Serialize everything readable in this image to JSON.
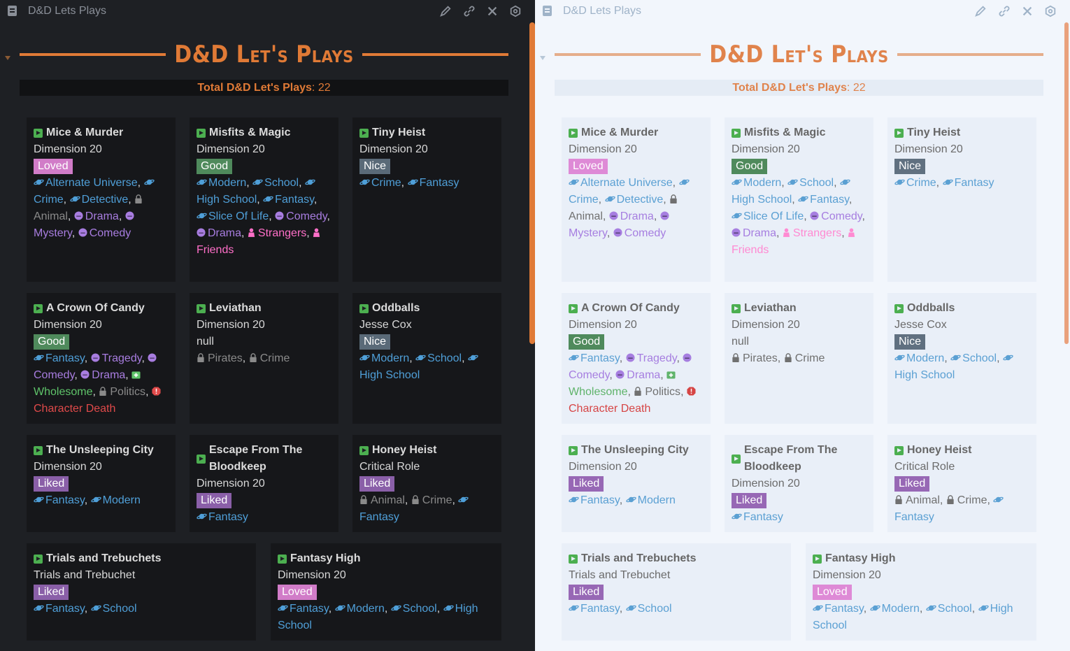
{
  "window": {
    "title": "D&D Lets Plays"
  },
  "heading": "D&D Let's Plays",
  "total": {
    "label": "Total D&D Let's Plays",
    "value": "22"
  },
  "colors": {
    "accent_dark": "#e07a36",
    "accent_light": "#e0834c",
    "genre_tag": "#4f9fd8",
    "mood_tag": "#a87de0",
    "relationship_tag": "#ff6fc8",
    "warning_tag": "#e04a4a",
    "wholesome_tag": "#5fc46a"
  },
  "cards": [
    {
      "name": "Mice & Murder",
      "creator": "Dimension 20",
      "rating": "Loved",
      "rating_class": "loved",
      "tags": [
        {
          "label": "Alternate Universe",
          "kind": "genre",
          "icon": "planet-icon"
        },
        {
          "label": "Crime",
          "kind": "genre",
          "icon": "planet-icon"
        },
        {
          "label": "Detective",
          "kind": "genre",
          "icon": "planet-icon"
        },
        {
          "label": "Animal",
          "kind": "neutral",
          "icon": "lock-icon"
        },
        {
          "label": "Drama",
          "kind": "mood",
          "icon": "face-icon"
        },
        {
          "label": "Mystery",
          "kind": "mood",
          "icon": "face-icon"
        },
        {
          "label": "Comedy",
          "kind": "mood",
          "icon": "face-icon"
        }
      ]
    },
    {
      "name": "Misfits & Magic",
      "creator": "Dimension 20",
      "rating": "Good",
      "rating_class": "good",
      "tags": [
        {
          "label": "Modern",
          "kind": "genre",
          "icon": "planet-icon"
        },
        {
          "label": "School",
          "kind": "genre",
          "icon": "planet-icon"
        },
        {
          "label": "High School",
          "kind": "genre",
          "icon": "planet-icon"
        },
        {
          "label": "Fantasy",
          "kind": "genre",
          "icon": "planet-icon"
        },
        {
          "label": "Slice Of Life",
          "kind": "genre",
          "icon": "planet-icon"
        },
        {
          "label": "Comedy",
          "kind": "mood",
          "icon": "face-icon"
        },
        {
          "label": "Drama",
          "kind": "mood",
          "icon": "face-icon"
        },
        {
          "label": "Strangers",
          "kind": "rel",
          "icon": "person-icon"
        },
        {
          "label": "Friends",
          "kind": "rel",
          "icon": "person-icon"
        }
      ]
    },
    {
      "name": "Tiny Heist",
      "creator": "Dimension 20",
      "rating": "Nice",
      "rating_class": "nice",
      "tags": [
        {
          "label": "Crime",
          "kind": "genre",
          "icon": "planet-icon"
        },
        {
          "label": "Fantasy",
          "kind": "genre",
          "icon": "planet-icon"
        }
      ]
    },
    {
      "name": "A Crown Of Candy",
      "creator": "Dimension 20",
      "rating": "Good",
      "rating_class": "good",
      "tags": [
        {
          "label": "Fantasy",
          "kind": "genre",
          "icon": "planet-icon"
        },
        {
          "label": "Tragedy",
          "kind": "mood",
          "icon": "face-icon"
        },
        {
          "label": "Comedy",
          "kind": "mood",
          "icon": "face-icon"
        },
        {
          "label": "Drama",
          "kind": "mood",
          "icon": "face-icon"
        },
        {
          "label": "Wholesome",
          "kind": "good",
          "icon": "medkit-icon"
        },
        {
          "label": "Politics",
          "kind": "neutral",
          "icon": "lock-icon"
        },
        {
          "label": "Character Death",
          "kind": "warn",
          "icon": "warning-icon"
        }
      ]
    },
    {
      "name": "Leviathan",
      "creator": "Dimension 20",
      "rating": "null",
      "rating_class": "none",
      "tags": [
        {
          "label": "Pirates",
          "kind": "neutral",
          "icon": "lock-icon"
        },
        {
          "label": "Crime",
          "kind": "neutral",
          "icon": "lock-icon"
        }
      ]
    },
    {
      "name": "Oddballs",
      "creator": "Jesse Cox",
      "rating": "Nice",
      "rating_class": "nice",
      "tags": [
        {
          "label": "Modern",
          "kind": "genre",
          "icon": "planet-icon"
        },
        {
          "label": "School",
          "kind": "genre",
          "icon": "planet-icon"
        },
        {
          "label": "High School",
          "kind": "genre",
          "icon": "planet-icon"
        }
      ]
    },
    {
      "name": "The Unsleeping City",
      "creator": "Dimension 20",
      "rating": "Liked",
      "rating_class": "liked",
      "tags": [
        {
          "label": "Fantasy",
          "kind": "genre",
          "icon": "planet-icon"
        },
        {
          "label": "Modern",
          "kind": "genre",
          "icon": "planet-icon"
        }
      ]
    },
    {
      "name": "Escape From The Bloodkeep",
      "creator": "Dimension 20",
      "rating": "Liked",
      "rating_class": "liked",
      "tags": [
        {
          "label": "Fantasy",
          "kind": "genre",
          "icon": "planet-icon"
        }
      ]
    },
    {
      "name": "Honey Heist",
      "creator": "Critical Role",
      "rating": "Liked",
      "rating_class": "liked",
      "tags": [
        {
          "label": "Animal",
          "kind": "neutral",
          "icon": "lock-icon"
        },
        {
          "label": "Crime",
          "kind": "neutral",
          "icon": "lock-icon"
        },
        {
          "label": "Fantasy",
          "kind": "genre",
          "icon": "planet-icon"
        }
      ]
    },
    {
      "name": "Trials and Trebuchets",
      "creator": "Trials and Trebuchet",
      "rating": "Liked",
      "rating_class": "liked",
      "tags": [
        {
          "label": "Fantasy",
          "kind": "genre",
          "icon": "planet-icon"
        },
        {
          "label": "School",
          "kind": "genre",
          "icon": "planet-icon"
        }
      ]
    },
    {
      "name": "Fantasy High",
      "creator": "Dimension 20",
      "rating": "Loved",
      "rating_class": "loved",
      "tags": [
        {
          "label": "Fantasy",
          "kind": "genre",
          "icon": "planet-icon"
        },
        {
          "label": "Modern",
          "kind": "genre",
          "icon": "planet-icon"
        },
        {
          "label": "School",
          "kind": "genre",
          "icon": "planet-icon"
        },
        {
          "label": "High School",
          "kind": "genre",
          "icon": "planet-icon"
        }
      ]
    }
  ]
}
